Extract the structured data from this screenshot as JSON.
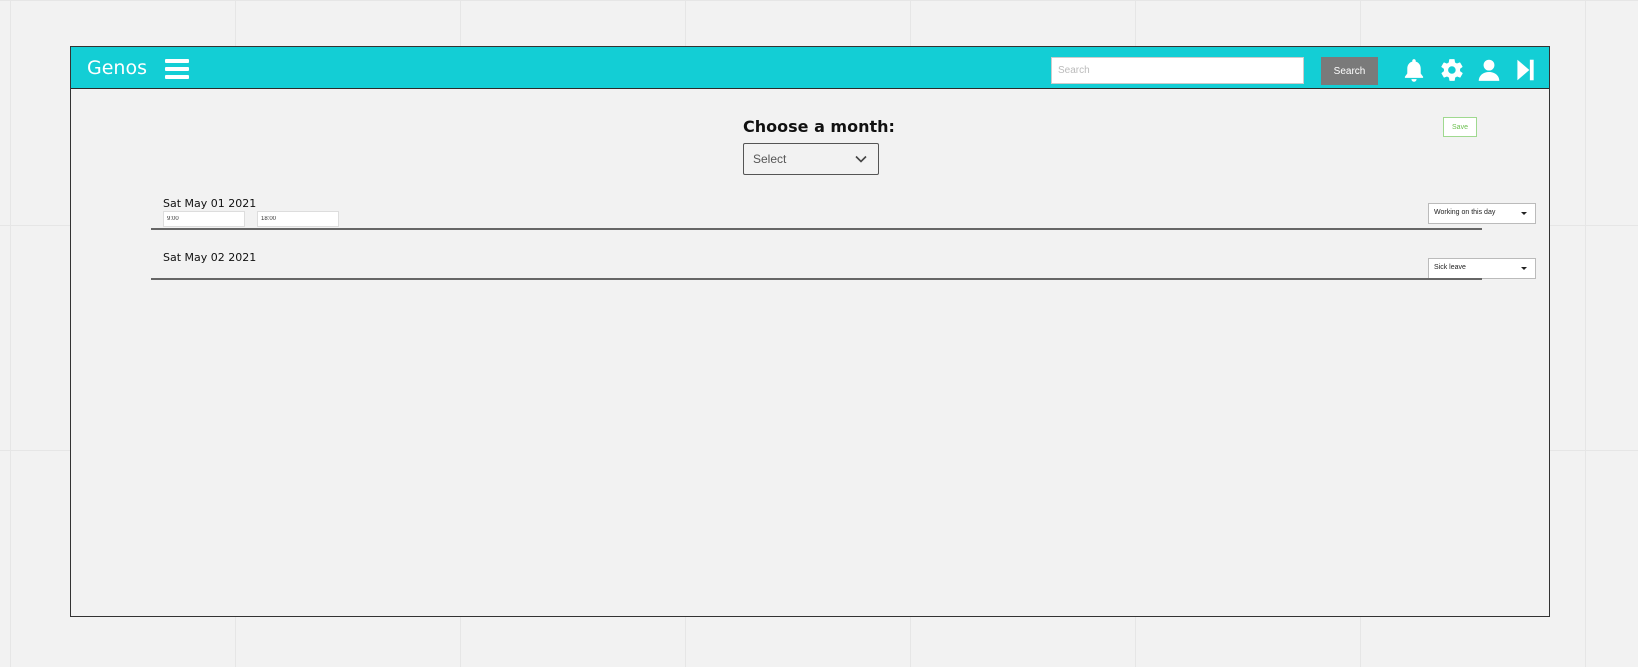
{
  "app": {
    "name": "Genos",
    "accent_color": "#13ced5"
  },
  "header": {
    "search_placeholder": "Search",
    "search_button_label": "Search",
    "icons": [
      "menu-icon",
      "bell-icon",
      "gear-icon",
      "user-icon",
      "logout-icon"
    ]
  },
  "main": {
    "save_label": "Save",
    "save_color": "#6cc050",
    "month_title": "Choose a month:",
    "month_select_value": "Select",
    "days": [
      {
        "date": "Sat May 01 2021",
        "start_time": "9:00",
        "end_time": "18:00",
        "status": "Working on this day"
      },
      {
        "date": "Sat May 02 2021",
        "status": "Sick leave"
      }
    ]
  }
}
